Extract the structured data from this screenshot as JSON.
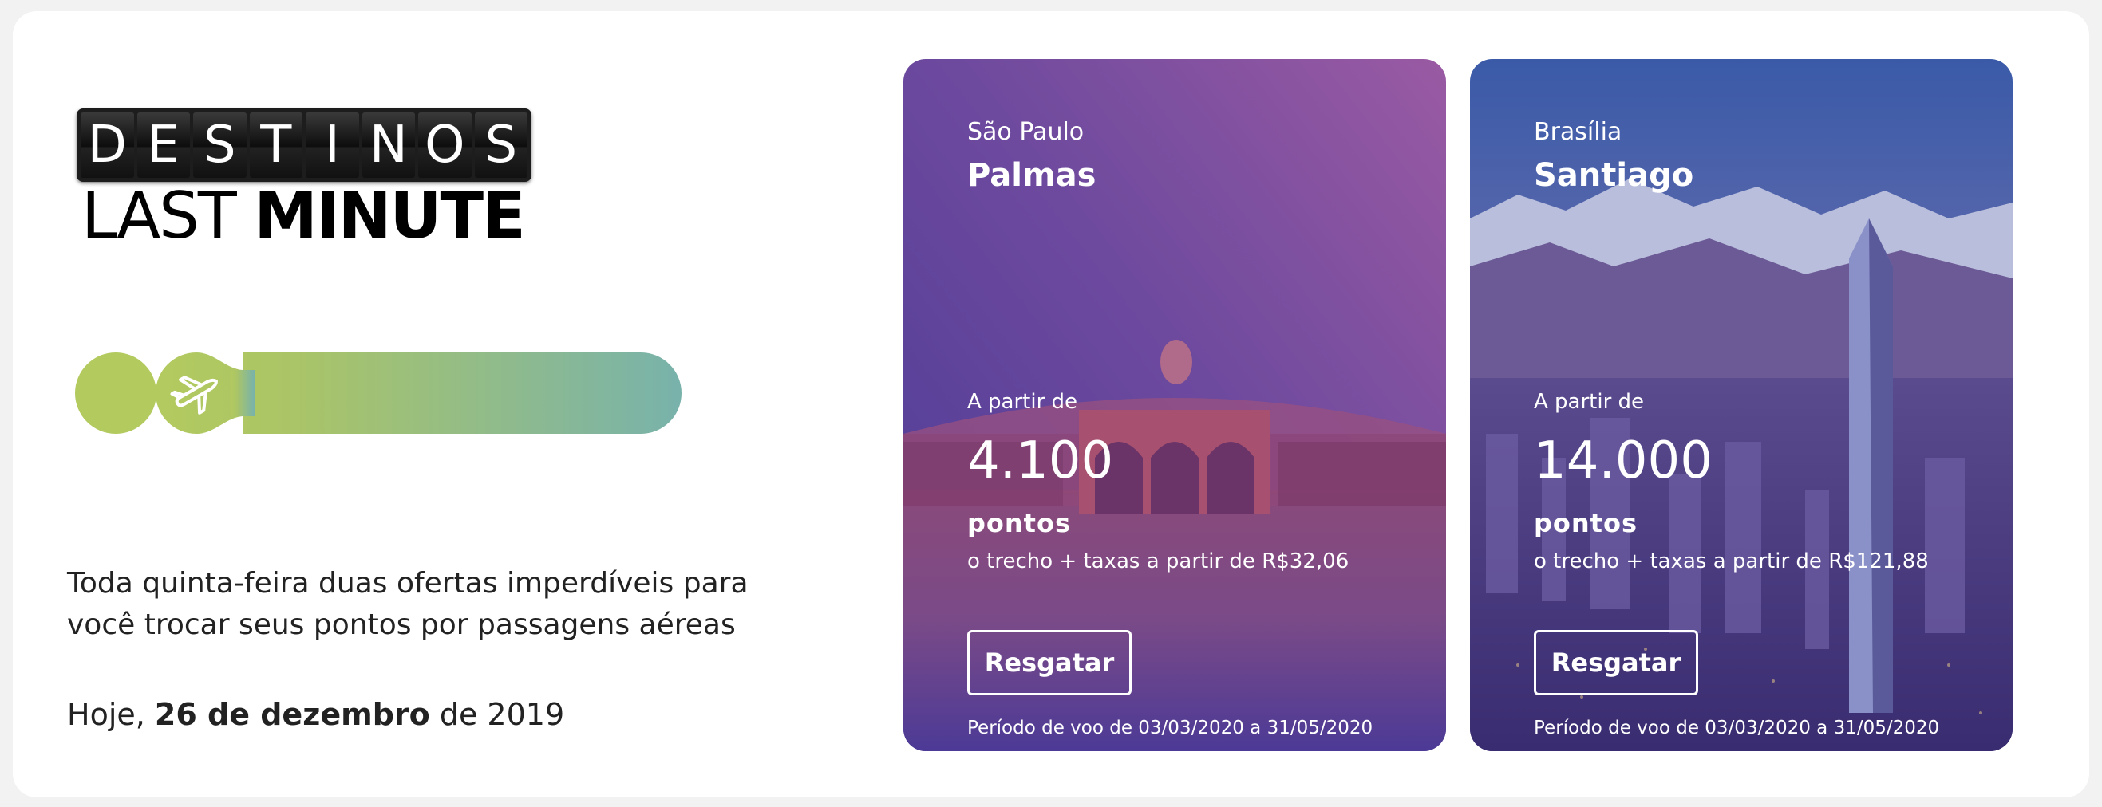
{
  "logo": {
    "letters": [
      "D",
      "E",
      "S",
      "T",
      "I",
      "N",
      "O",
      "S"
    ],
    "sub_light": "LAST",
    "sub_bold": "MINUTE"
  },
  "intro": {
    "description": "Toda quinta-feira duas ofertas imperdíveis para você trocar seus pontos por passagens aéreas",
    "date_prefix": "Hoje, ",
    "date_bold": "26 de dezembro",
    "date_suffix": " de 2019"
  },
  "colors": {
    "accent_green": "#b3ca5f",
    "accent_teal": "#7ab3aa",
    "card_purple": "#5a3f9a",
    "card_pink": "#b04f86"
  },
  "offers": [
    {
      "origin": "São Paulo",
      "destination": "Palmas",
      "from_label": "A partir de",
      "points": "4.100",
      "points_unit": "pontos",
      "fees": "o trecho + taxas a partir de R$32,06",
      "button": "Resgatar",
      "period": "Período de voo de 03/03/2020 a 31/05/2020"
    },
    {
      "origin": "Brasília",
      "destination": "Santiago",
      "from_label": "A partir de",
      "points": "14.000",
      "points_unit": "pontos",
      "fees": "o trecho + taxas a partir de R$121,88",
      "button": "Resgatar",
      "period": "Período de voo de 03/03/2020 a 31/05/2020"
    }
  ],
  "icons": {
    "pill": "airplane-icon"
  }
}
